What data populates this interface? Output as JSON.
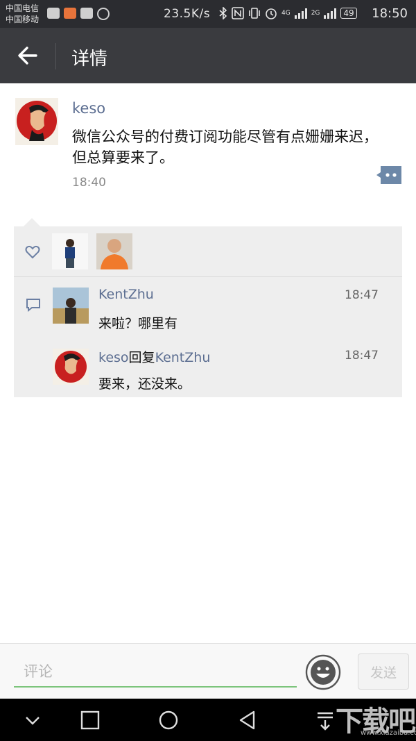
{
  "status_bar": {
    "carrier_1": "中国电信",
    "carrier_2": "中国移动",
    "net_speed": "23.5K/s",
    "network_1": "4G",
    "network_2": "2G",
    "battery": "49",
    "time": "18:50"
  },
  "header": {
    "title": "详情",
    "back_icon": "back-arrow-icon"
  },
  "post": {
    "author": "keso",
    "content": "微信公众号的付费订阅功能尽管有点姗姗来迟，但总算要来了。",
    "time": "18:40"
  },
  "comments": [
    {
      "name": "KentZhu",
      "time": "18:47",
      "text": "来啦？哪里有"
    },
    {
      "name": "keso",
      "reply_word": "回复",
      "reply_to": "KentZhu",
      "time": "18:47",
      "text": "要来，还没来。"
    }
  ],
  "composer": {
    "placeholder": "评论",
    "send_label": "发送"
  },
  "watermark": {
    "text": "下载吧",
    "url": "www.xiazaiba.com"
  },
  "colors": {
    "accent_green": "#7cc47b",
    "link_blue": "#5c6e91",
    "titlebar": "#3a3b3f"
  }
}
